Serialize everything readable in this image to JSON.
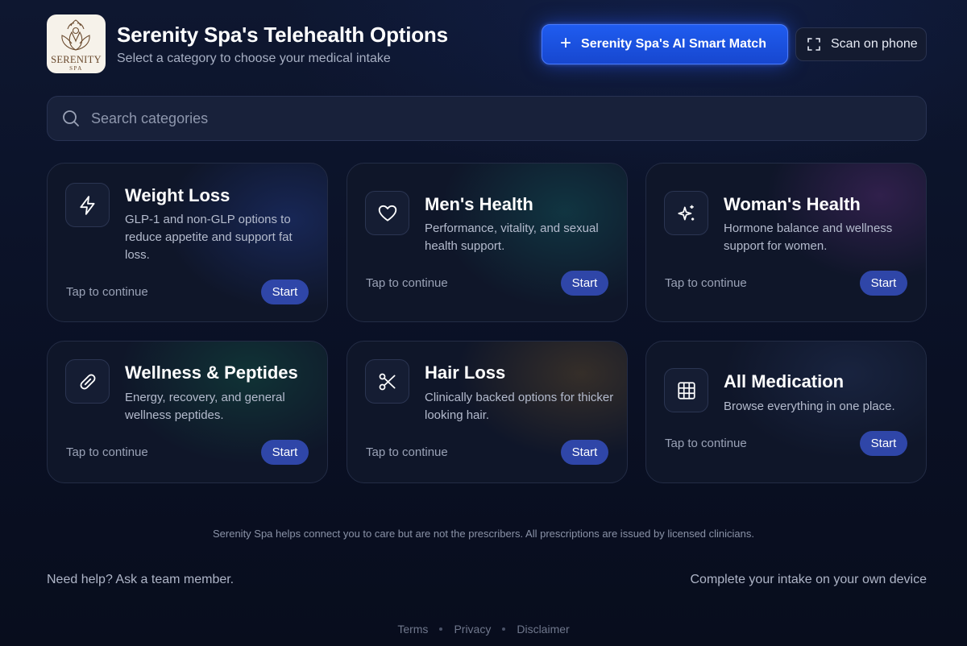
{
  "header": {
    "logo_text": "SERENITY",
    "logo_sub": "SPA",
    "title": "Serenity Spa's Telehealth Options",
    "subtitle": "Select a category to choose your medical intake",
    "ai_button_label": "Serenity Spa's AI Smart Match",
    "scan_button_label": "Scan on phone"
  },
  "search": {
    "placeholder": "Search categories",
    "value": ""
  },
  "cards": [
    {
      "title": "Weight Loss",
      "description": "GLP-1 and non-GLP options to reduce appetite and support fat loss.",
      "tap_label": "Tap to continue",
      "start_label": "Start",
      "icon": "lightning-icon"
    },
    {
      "title": "Men's Health",
      "description": "Performance, vitality, and sexual health support.",
      "tap_label": "Tap to continue",
      "start_label": "Start",
      "icon": "heart-icon"
    },
    {
      "title": "Woman's Health",
      "description": "Hormone balance and wellness support for women.",
      "tap_label": "Tap to continue",
      "start_label": "Start",
      "icon": "sparkles-icon"
    },
    {
      "title": "Wellness & Peptides",
      "description": "Energy, recovery, and general wellness peptides.",
      "tap_label": "Tap to continue",
      "start_label": "Start",
      "icon": "pill-icon"
    },
    {
      "title": "Hair Loss",
      "description": "Clinically backed options for thicker looking hair.",
      "tap_label": "Tap to continue",
      "start_label": "Start",
      "icon": "scissors-icon"
    },
    {
      "title": "All Medication",
      "description": "Browse everything in one place.",
      "tap_label": "Tap to continue",
      "start_label": "Start",
      "icon": "grid-icon"
    }
  ],
  "footer": {
    "disclaimer": "Serenity Spa helps connect you to care but are not the prescribers. All prescriptions are issued by licensed clinicians.",
    "help": "Need help? Ask a team member.",
    "own_device": "Complete your intake on your own device",
    "links": [
      "Terms",
      "Privacy",
      "Disclaimer"
    ]
  },
  "colors": {
    "background": "#0b1226",
    "accent": "#1f5cf0",
    "start_button": "#2f46a8",
    "card": "#0f1629"
  }
}
